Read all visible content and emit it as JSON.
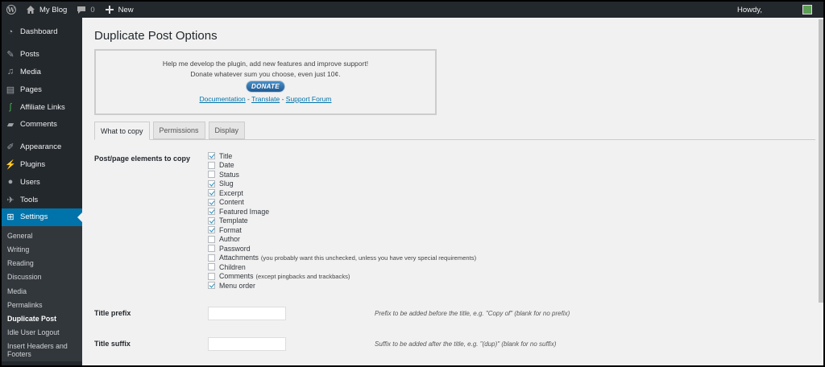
{
  "adminbar": {
    "site_name": "My Blog",
    "comments_count": "0",
    "new_label": "New",
    "howdy": "Howdy,"
  },
  "sidebar": {
    "items": [
      {
        "label": "Dashboard",
        "icon": "dashboard-icon"
      },
      {
        "label": "Posts",
        "icon": "pin-icon"
      },
      {
        "label": "Media",
        "icon": "media-icon"
      },
      {
        "label": "Pages",
        "icon": "pages-icon"
      },
      {
        "label": "Affiliate Links",
        "icon": "affiliate-icon"
      },
      {
        "label": "Comments",
        "icon": "comment-icon"
      },
      {
        "label": "Appearance",
        "icon": "brush-icon"
      },
      {
        "label": "Plugins",
        "icon": "plug-icon"
      },
      {
        "label": "Users",
        "icon": "user-icon"
      },
      {
        "label": "Tools",
        "icon": "wrench-icon"
      },
      {
        "label": "Settings",
        "icon": "settings-icon"
      }
    ],
    "submenu": [
      "General",
      "Writing",
      "Reading",
      "Discussion",
      "Media",
      "Permalinks",
      "Duplicate Post",
      "Idle User Logout",
      "Insert Headers and Footers"
    ]
  },
  "page": {
    "title": "Duplicate Post Options"
  },
  "donate": {
    "line1": "Help me develop the plugin, add new features and improve support!",
    "line2": "Donate whatever sum you choose, even just 10¢.",
    "button": "DONATE",
    "link_documentation": "Documentation",
    "sep1": " - ",
    "link_translate": "Translate",
    "sep2": " - ",
    "link_support": "Support Forum"
  },
  "tabs": [
    "What to copy",
    "Permissions",
    "Display"
  ],
  "elements": {
    "label": "Post/page elements to copy",
    "options": [
      {
        "label": "Title",
        "checked": true,
        "note": ""
      },
      {
        "label": "Date",
        "checked": false,
        "note": ""
      },
      {
        "label": "Status",
        "checked": false,
        "note": ""
      },
      {
        "label": "Slug",
        "checked": true,
        "note": ""
      },
      {
        "label": "Excerpt",
        "checked": true,
        "note": ""
      },
      {
        "label": "Content",
        "checked": true,
        "note": ""
      },
      {
        "label": "Featured Image",
        "checked": true,
        "note": ""
      },
      {
        "label": "Template",
        "checked": true,
        "note": ""
      },
      {
        "label": "Format",
        "checked": true,
        "note": ""
      },
      {
        "label": "Author",
        "checked": false,
        "note": ""
      },
      {
        "label": "Password",
        "checked": false,
        "note": ""
      },
      {
        "label": "Attachments",
        "checked": false,
        "note": "(you probably want this unchecked, unless you have very special requirements)"
      },
      {
        "label": "Children",
        "checked": false,
        "note": ""
      },
      {
        "label": "Comments",
        "checked": false,
        "note": "(except pingbacks and trackbacks)"
      },
      {
        "label": "Menu order",
        "checked": true,
        "note": ""
      }
    ]
  },
  "title_prefix": {
    "label": "Title prefix",
    "value": "",
    "hint": "Prefix to be added before the title, e.g. \"Copy of\" (blank for no prefix)"
  },
  "title_suffix": {
    "label": "Title suffix",
    "value": "",
    "hint": "Suffix to be added after the title, e.g. \"(dup)\" (blank for no suffix)"
  },
  "colors": {
    "adminbar": "#23282d",
    "sidebar": "#23282d",
    "submenu": "#32373c",
    "active": "#0073aa",
    "content_bg": "#f1f1f1",
    "link": "#0073aa"
  }
}
